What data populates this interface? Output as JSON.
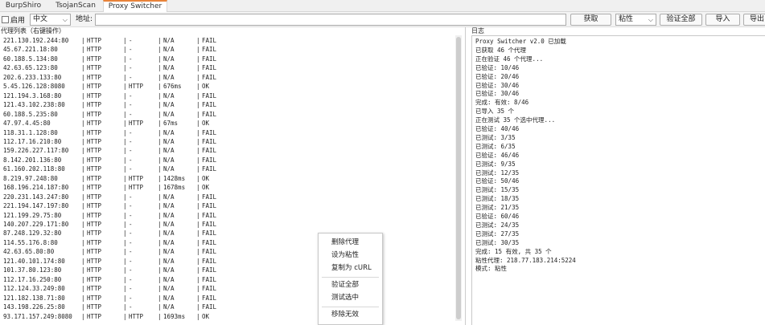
{
  "tabs": [
    {
      "label": "BurpShiro",
      "active": false
    },
    {
      "label": "TsojanScan",
      "active": false
    },
    {
      "label": "Proxy Switcher",
      "active": true
    }
  ],
  "toolbar": {
    "enable_label": "启用",
    "lang_value": "中文",
    "address_label": "地址:",
    "address_value": "",
    "fetch_button": "获取",
    "paste_value": "粘性",
    "verify_all_button": "验证全部",
    "import_button": "导入",
    "export_button": "导出"
  },
  "left_title": "代理列表（右键操作）",
  "right_title": "日志",
  "proxies": [
    {
      "addr": "221.130.192.244:80",
      "type": "HTTP",
      "res": "-",
      "latency": "N/A",
      "status": "FAIL"
    },
    {
      "addr": "45.67.221.18:80",
      "type": "HTTP",
      "res": "-",
      "latency": "N/A",
      "status": "FAIL"
    },
    {
      "addr": "60.188.5.134:80",
      "type": "HTTP",
      "res": "-",
      "latency": "N/A",
      "status": "FAIL"
    },
    {
      "addr": "42.63.65.123:80",
      "type": "HTTP",
      "res": "-",
      "latency": "N/A",
      "status": "FAIL"
    },
    {
      "addr": "202.6.233.133:80",
      "type": "HTTP",
      "res": "-",
      "latency": "N/A",
      "status": "FAIL"
    },
    {
      "addr": "5.45.126.128:8080",
      "type": "HTTP",
      "res": "HTTP",
      "latency": "676ms",
      "status": "OK"
    },
    {
      "addr": "121.194.3.168:80",
      "type": "HTTP",
      "res": "-",
      "latency": "N/A",
      "status": "FAIL"
    },
    {
      "addr": "121.43.102.238:80",
      "type": "HTTP",
      "res": "-",
      "latency": "N/A",
      "status": "FAIL"
    },
    {
      "addr": "60.188.5.235:80",
      "type": "HTTP",
      "res": "-",
      "latency": "N/A",
      "status": "FAIL"
    },
    {
      "addr": "47.97.4.45:80",
      "type": "HTTP",
      "res": "HTTP",
      "latency": "67ms",
      "status": "OK"
    },
    {
      "addr": "118.31.1.128:80",
      "type": "HTTP",
      "res": "-",
      "latency": "N/A",
      "status": "FAIL"
    },
    {
      "addr": "112.17.16.210:80",
      "type": "HTTP",
      "res": "-",
      "latency": "N/A",
      "status": "FAIL"
    },
    {
      "addr": "159.226.227.117:80",
      "type": "HTTP",
      "res": "-",
      "latency": "N/A",
      "status": "FAIL"
    },
    {
      "addr": "8.142.201.136:80",
      "type": "HTTP",
      "res": "-",
      "latency": "N/A",
      "status": "FAIL"
    },
    {
      "addr": "61.160.202.118:80",
      "type": "HTTP",
      "res": "-",
      "latency": "N/A",
      "status": "FAIL"
    },
    {
      "addr": "8.219.97.248:80",
      "type": "HTTP",
      "res": "HTTP",
      "latency": "1428ms",
      "status": "OK"
    },
    {
      "addr": "168.196.214.187:80",
      "type": "HTTP",
      "res": "HTTP",
      "latency": "1678ms",
      "status": "OK"
    },
    {
      "addr": "220.231.143.247:80",
      "type": "HTTP",
      "res": "-",
      "latency": "N/A",
      "status": "FAIL"
    },
    {
      "addr": "221.194.147.197:80",
      "type": "HTTP",
      "res": "-",
      "latency": "N/A",
      "status": "FAIL"
    },
    {
      "addr": "121.199.29.75:80",
      "type": "HTTP",
      "res": "-",
      "latency": "N/A",
      "status": "FAIL"
    },
    {
      "addr": "140.207.229.171:80",
      "type": "HTTP",
      "res": "-",
      "latency": "N/A",
      "status": "FAIL"
    },
    {
      "addr": "87.248.129.32:80",
      "type": "HTTP",
      "res": "-",
      "latency": "N/A",
      "status": "FAIL"
    },
    {
      "addr": "114.55.176.8:80",
      "type": "HTTP",
      "res": "-",
      "latency": "N/A",
      "status": "FAIL"
    },
    {
      "addr": "42.63.65.80:80",
      "type": "HTTP",
      "res": "-",
      "latency": "N/A",
      "status": "FAIL"
    },
    {
      "addr": "121.40.101.174:80",
      "type": "HTTP",
      "res": "-",
      "latency": "N/A",
      "status": "FAIL"
    },
    {
      "addr": "101.37.80.123:80",
      "type": "HTTP",
      "res": "-",
      "latency": "N/A",
      "status": "FAIL"
    },
    {
      "addr": "112.17.16.250:80",
      "type": "HTTP",
      "res": "-",
      "latency": "N/A",
      "status": "FAIL"
    },
    {
      "addr": "112.124.33.249:80",
      "type": "HTTP",
      "res": "-",
      "latency": "N/A",
      "status": "FAIL"
    },
    {
      "addr": "121.182.138.71:80",
      "type": "HTTP",
      "res": "-",
      "latency": "N/A",
      "status": "FAIL"
    },
    {
      "addr": "143.198.226.25:80",
      "type": "HTTP",
      "res": "-",
      "latency": "N/A",
      "status": "FAIL"
    },
    {
      "addr": "93.171.157.249:8080",
      "type": "HTTP",
      "res": "HTTP",
      "latency": "1693ms",
      "status": "OK"
    }
  ],
  "log_lines": [
    "Proxy Switcher v2.0 已加载",
    "已获取 46 个代理",
    "正在验证 46 个代理...",
    "已验证: 10/46",
    "已验证: 20/46",
    "已验证: 30/46",
    "已验证: 30/46",
    "完成: 有效: 8/46",
    "已导入 35 个",
    "正在测试 35 个选中代理...",
    "已验证: 40/46",
    "已测试: 3/35",
    "已测试: 6/35",
    "已验证: 46/46",
    "已测试: 9/35",
    "已测试: 12/35",
    "已验证: 50/46",
    "已测试: 15/35",
    "已测试: 18/35",
    "已测试: 21/35",
    "已验证: 60/46",
    "已测试: 24/35",
    "已测试: 27/35",
    "已测试: 30/35",
    "完成: 15 有效, 共 35 个",
    "粘性代理: 218.77.183.214:5224",
    "模式: 粘性"
  ],
  "context_menu": {
    "items": [
      "删除代理",
      "设为粘性",
      "复制为 cURL",
      "验证全部",
      "测试选中",
      "移除无效"
    ]
  }
}
